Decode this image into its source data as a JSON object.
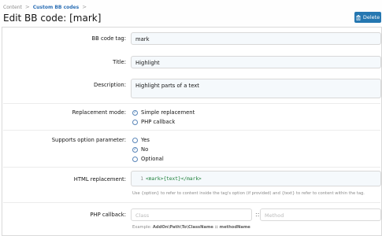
{
  "breadcrumb": {
    "items": [
      "Content",
      "Custom BB codes"
    ],
    "separators": [
      ">",
      ">"
    ]
  },
  "header": {
    "title": "Edit BB code: [mark]",
    "delete_label": "Delete",
    "accent_color": "#2577b1"
  },
  "form": {
    "bb_code_tag": {
      "label": "BB code tag:",
      "value": "mark"
    },
    "title": {
      "label": "Title:",
      "value": "Highlight"
    },
    "description": {
      "label": "Description:",
      "value": "Highlight parts of a text"
    },
    "replacement_mode": {
      "label": "Replacement mode:",
      "options": [
        {
          "label": "Simple replacement",
          "selected": true
        },
        {
          "label": "PHP callback",
          "selected": false
        }
      ]
    },
    "supports_option": {
      "label": "Supports option parameter:",
      "options": [
        {
          "label": "Yes",
          "selected": false
        },
        {
          "label": "No",
          "selected": true
        },
        {
          "label": "Optional",
          "selected": false
        }
      ]
    },
    "html_replacement": {
      "label": "HTML replacement:",
      "line_number": "1",
      "code": "<mark>{text}</mark>",
      "help": "Use {option} to refer to content inside the tag's option (if provided) and {text} to refer to content within the tag."
    },
    "php_callback": {
      "label": "PHP callback:",
      "class_placeholder": "Class",
      "separator": "::",
      "method_placeholder": "Method",
      "example_prefix": "Example: ",
      "example_value": "AddOn\\Path\\To\\ClassName :: methodName"
    }
  }
}
